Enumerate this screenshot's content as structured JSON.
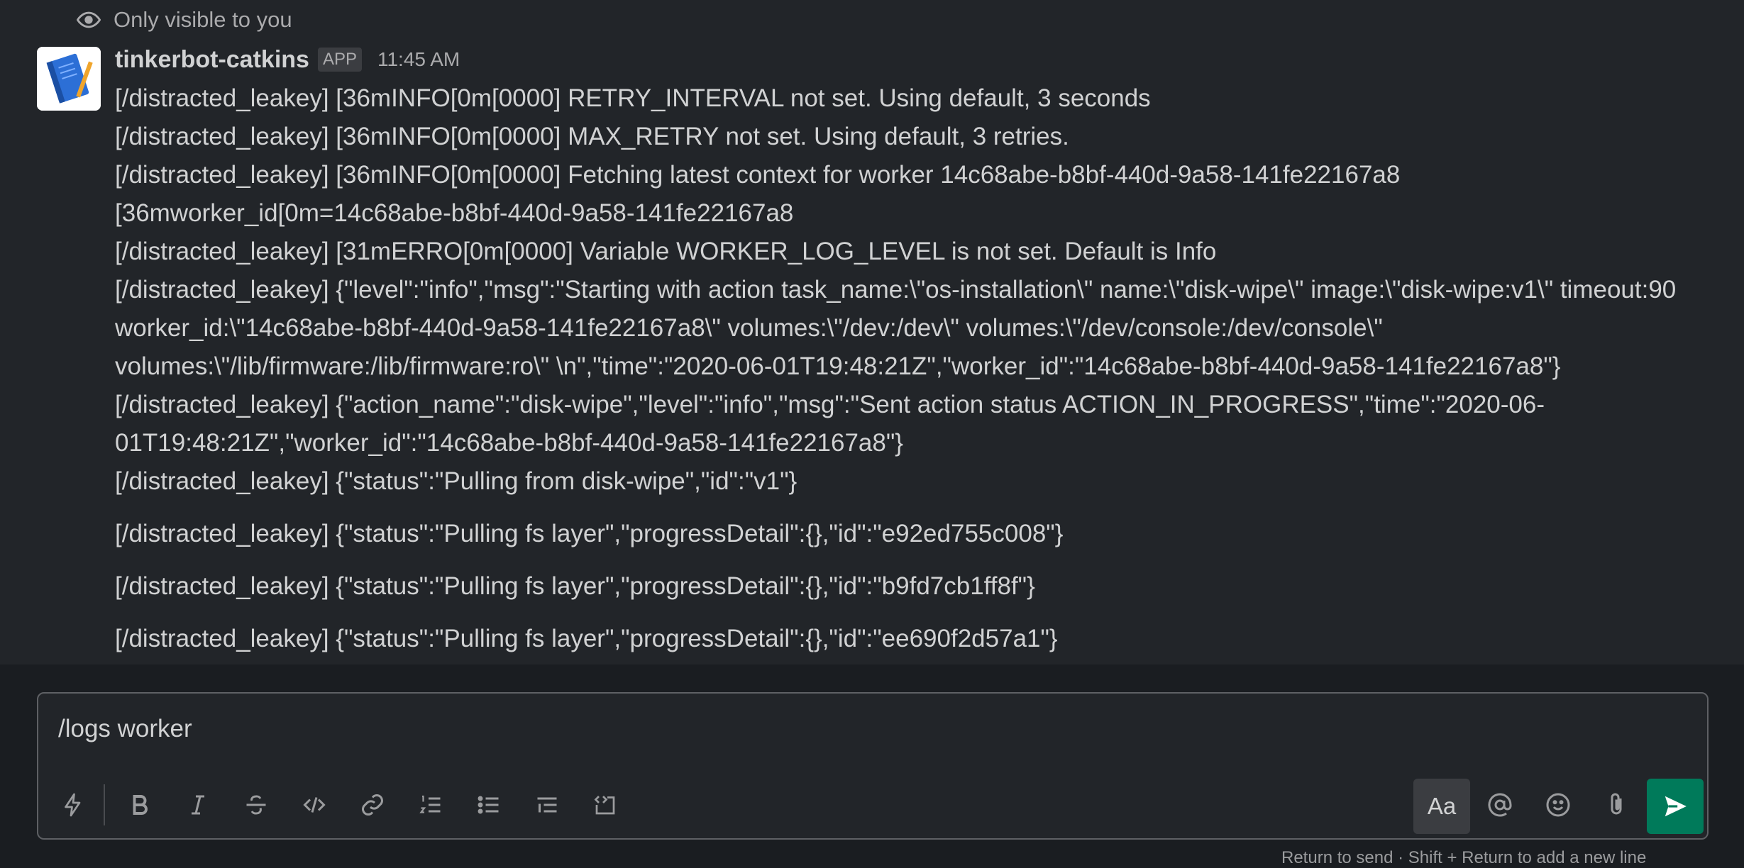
{
  "visibility_note": "Only visible to you",
  "message": {
    "sender": "tinkerbot-catkins",
    "badge": "APP",
    "time": "11:45 AM",
    "lines": [
      "[/distracted_leakey] [36mINFO[0m[0000] RETRY_INTERVAL not set. Using default, 3 seconds",
      "[/distracted_leakey] [36mINFO[0m[0000] MAX_RETRY not set. Using default, 3 retries.",
      "[/distracted_leakey] [36mINFO[0m[0000] Fetching latest context for worker 14c68abe-b8bf-440d-9a58-141fe22167a8",
      "[36mworker_id[0m=14c68abe-b8bf-440d-9a58-141fe22167a8",
      "[/distracted_leakey] [31mERRO[0m[0000] Variable WORKER_LOG_LEVEL is not set. Default is Info",
      "[/distracted_leakey] {\"level\":\"info\",\"msg\":\"Starting with action task_name:\\\"os-installation\\\" name:\\\"disk-wipe\\\" image:\\\"disk-wipe:v1\\\" timeout:90 worker_id:\\\"14c68abe-b8bf-440d-9a58-141fe22167a8\\\" volumes:\\\"/dev:/dev\\\" volumes:\\\"/dev/console:/dev/console\\\" volumes:\\\"/lib/firmware:/lib/firmware:ro\\\" \\n\",\"time\":\"2020-06-01T19:48:21Z\",\"worker_id\":\"14c68abe-b8bf-440d-9a58-141fe22167a8\"}",
      "[/distracted_leakey] {\"action_name\":\"disk-wipe\",\"level\":\"info\",\"msg\":\"Sent action status  ACTION_IN_PROGRESS\",\"time\":\"2020-06-01T19:48:21Z\",\"worker_id\":\"14c68abe-b8bf-440d-9a58-141fe22167a8\"}",
      "[/distracted_leakey] {\"status\":\"Pulling from disk-wipe\",\"id\":\"v1\"}",
      "[/distracted_leakey] {\"status\":\"Pulling fs layer\",\"progressDetail\":{},\"id\":\"e92ed755c008\"}",
      "[/distracted_leakey] {\"status\":\"Pulling fs layer\",\"progressDetail\":{},\"id\":\"b9fd7cb1ff8f\"}",
      "[/distracted_leakey] {\"status\":\"Pulling fs layer\",\"progressDetail\":{},\"id\":\"ee690f2d57a1\"}"
    ]
  },
  "composer": {
    "value": "/logs worker",
    "format_label": "Aa",
    "hint": "Return to send · Shift + Return to add a new line"
  },
  "icons": {
    "visibility": "eye-icon",
    "shortcuts": "lightning-icon",
    "bold": "bold-icon",
    "italic": "italic-icon",
    "strike": "strikethrough-icon",
    "code": "code-icon",
    "link": "link-icon",
    "ordered_list": "ordered-list-icon",
    "bulleted_list": "bulleted-list-icon",
    "blockquote": "blockquote-icon",
    "code_block": "code-block-icon",
    "mention": "at-sign-icon",
    "emoji": "emoji-icon",
    "attach": "paperclip-icon",
    "send": "send-icon"
  },
  "colors": {
    "send_button": "#007a5a",
    "background": "#1a1d21",
    "message_area": "#222529"
  }
}
